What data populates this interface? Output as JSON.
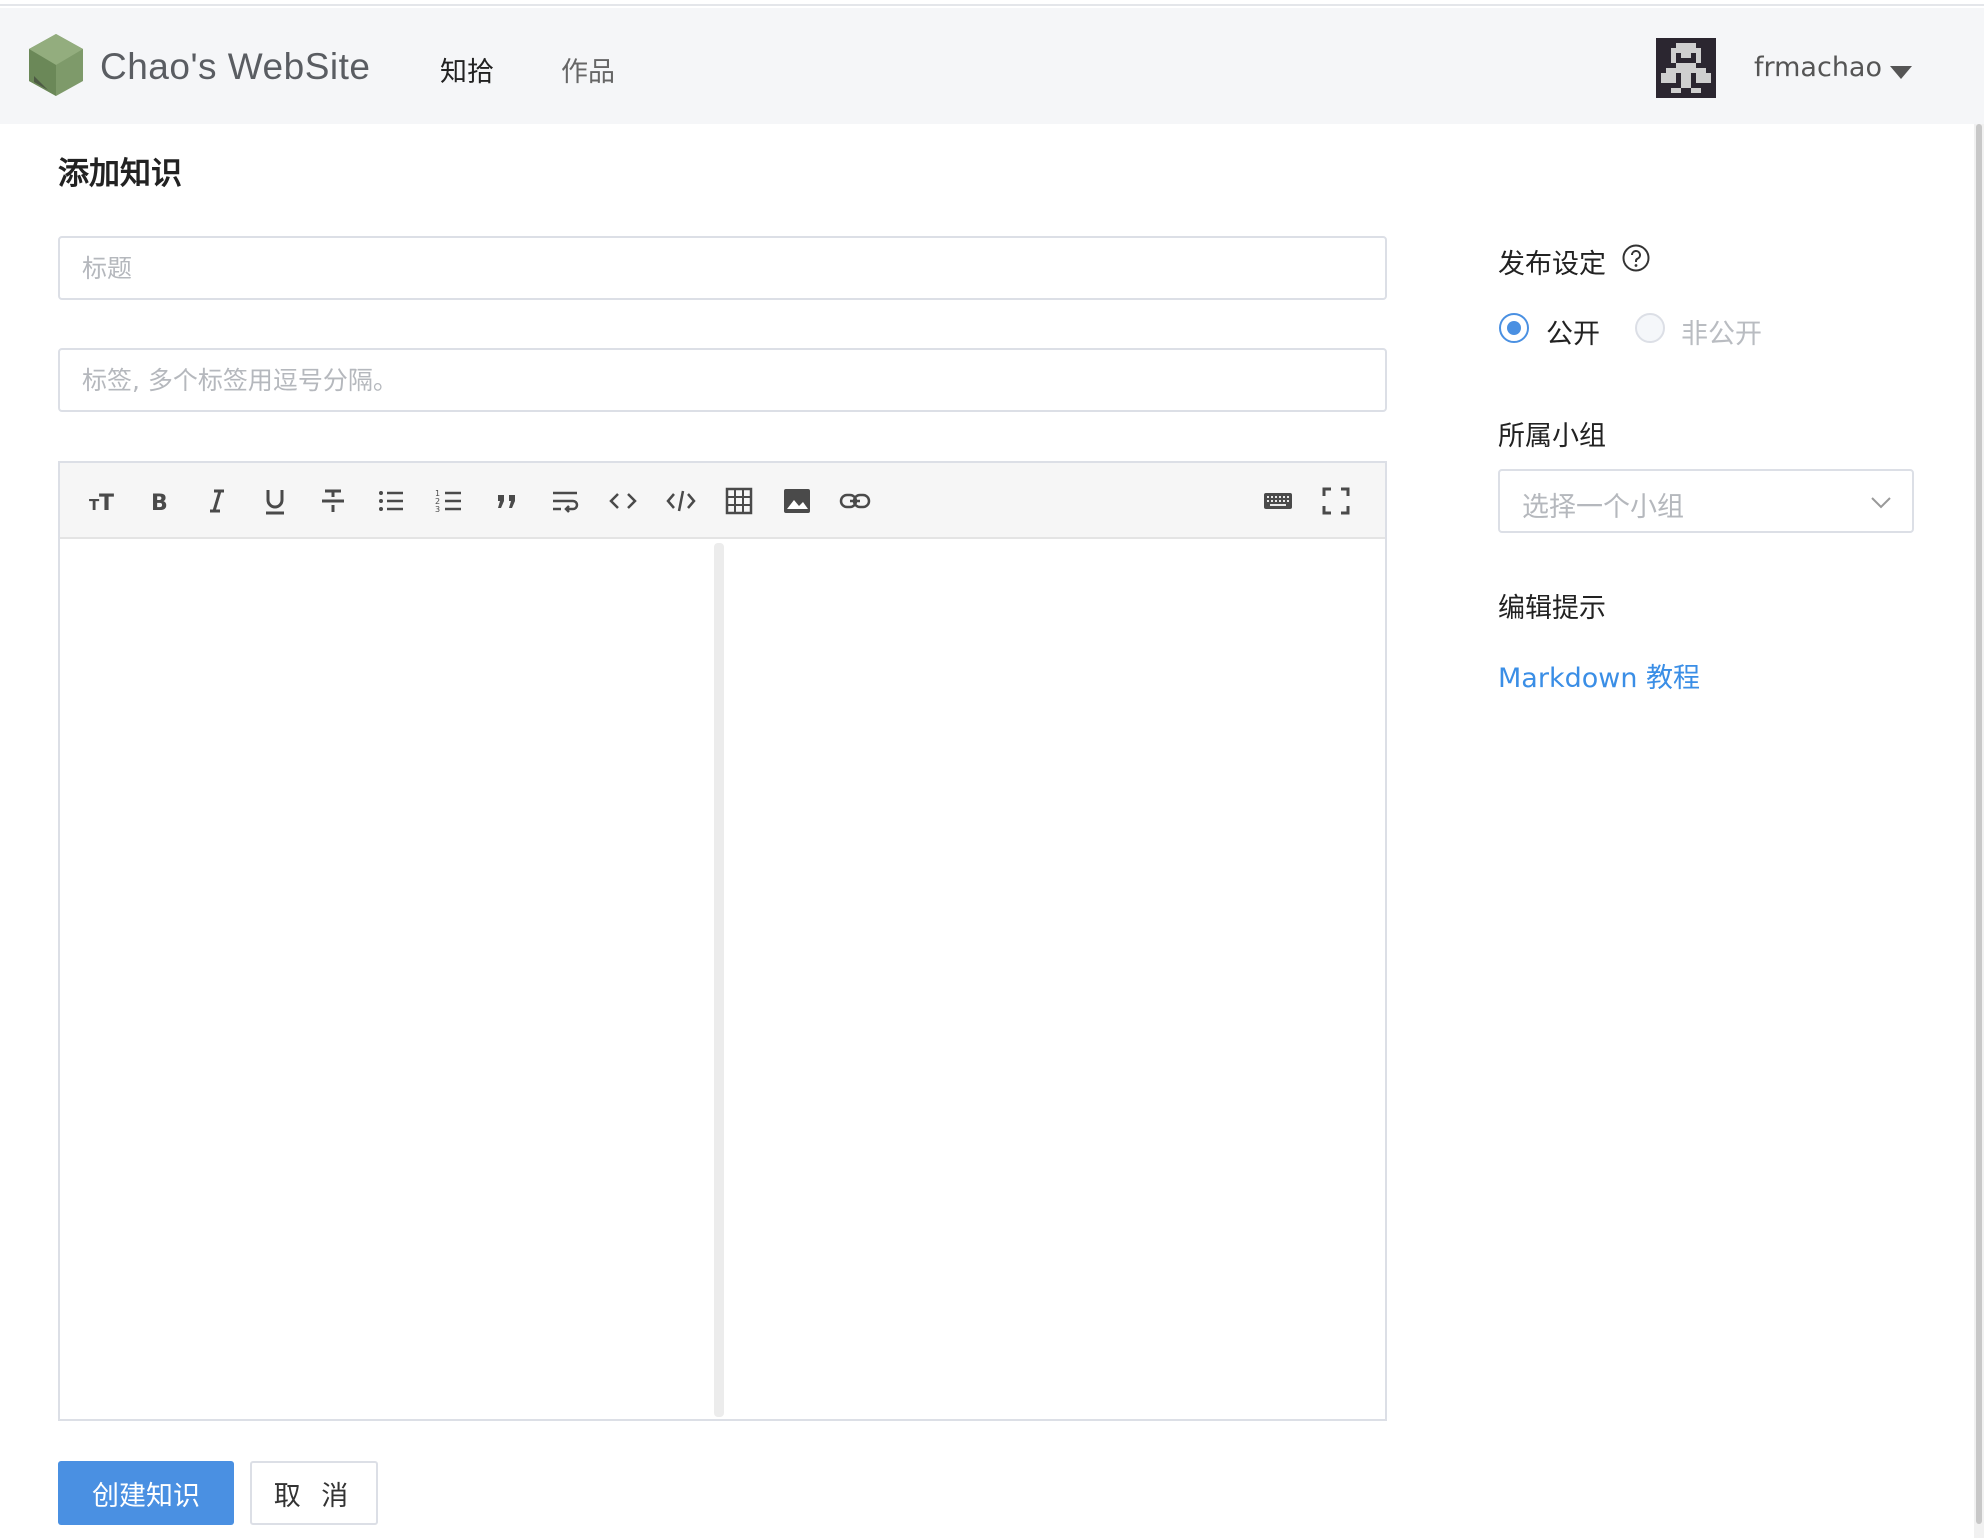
{
  "header": {
    "site_title": "Chao's WebSite",
    "nav": [
      {
        "label": "知拾"
      },
      {
        "label": "作品"
      }
    ],
    "username": "frmachao"
  },
  "page_title": "添加知识",
  "form": {
    "title_placeholder": "标题",
    "tags_placeholder": "标签, 多个标签用逗号分隔。"
  },
  "editor": {
    "toolbar_icons": [
      "header-icon",
      "bold-icon",
      "italic-icon",
      "underline-icon",
      "strikethrough-icon",
      "bullet-list-icon",
      "ordered-list-icon",
      "quote-icon",
      "wrap-icon",
      "code-icon",
      "code-block-icon",
      "table-icon",
      "image-icon",
      "link-icon",
      "keyboard-icon",
      "fullscreen-icon"
    ]
  },
  "buttons": {
    "create": "创建知识",
    "cancel": "取 消"
  },
  "sidebar": {
    "publish_label": "发布设定",
    "radio_public": "公开",
    "radio_private": "非公开",
    "selected_visibility": "公开",
    "group_label": "所属小组",
    "group_placeholder": "选择一个小组",
    "tips_label": "编辑提示",
    "markdown_link": "Markdown 教程"
  },
  "colors": {
    "primary": "#4a90e2",
    "link": "#3a8ee6",
    "header_bg": "#f5f6f8"
  }
}
